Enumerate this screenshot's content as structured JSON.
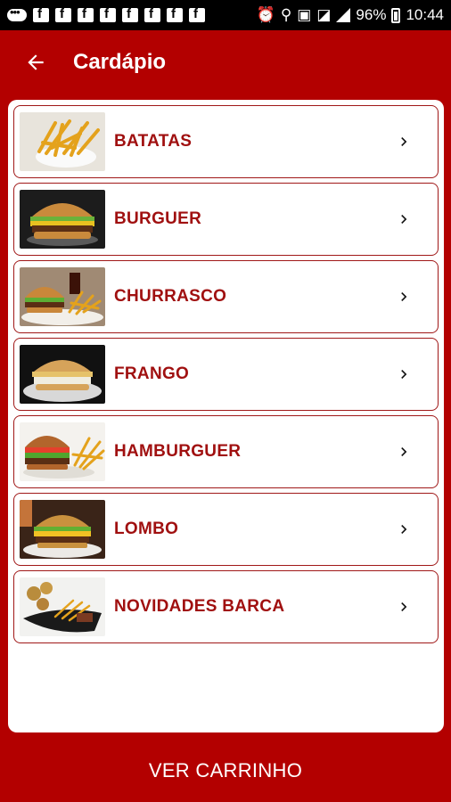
{
  "status_bar": {
    "battery": "96%",
    "time": "10:44"
  },
  "header": {
    "title": "Cardápio"
  },
  "categories": [
    {
      "label": "BATATAS",
      "icon": "fries-photo"
    },
    {
      "label": "BURGUER",
      "icon": "burger-photo"
    },
    {
      "label": "CHURRASCO",
      "icon": "burger-fries-photo"
    },
    {
      "label": "FRANGO",
      "icon": "chicken-sandwich-photo"
    },
    {
      "label": "HAMBURGUER",
      "icon": "hamburger-photo"
    },
    {
      "label": "LOMBO",
      "icon": "lombo-photo"
    },
    {
      "label": "NOVIDADES BARCA",
      "icon": "barca-photo"
    }
  ],
  "footer": {
    "cart_label": "VER CARRINHO"
  },
  "colors": {
    "primary": "#b30000",
    "label": "#a01010",
    "card": "#ffffff"
  }
}
